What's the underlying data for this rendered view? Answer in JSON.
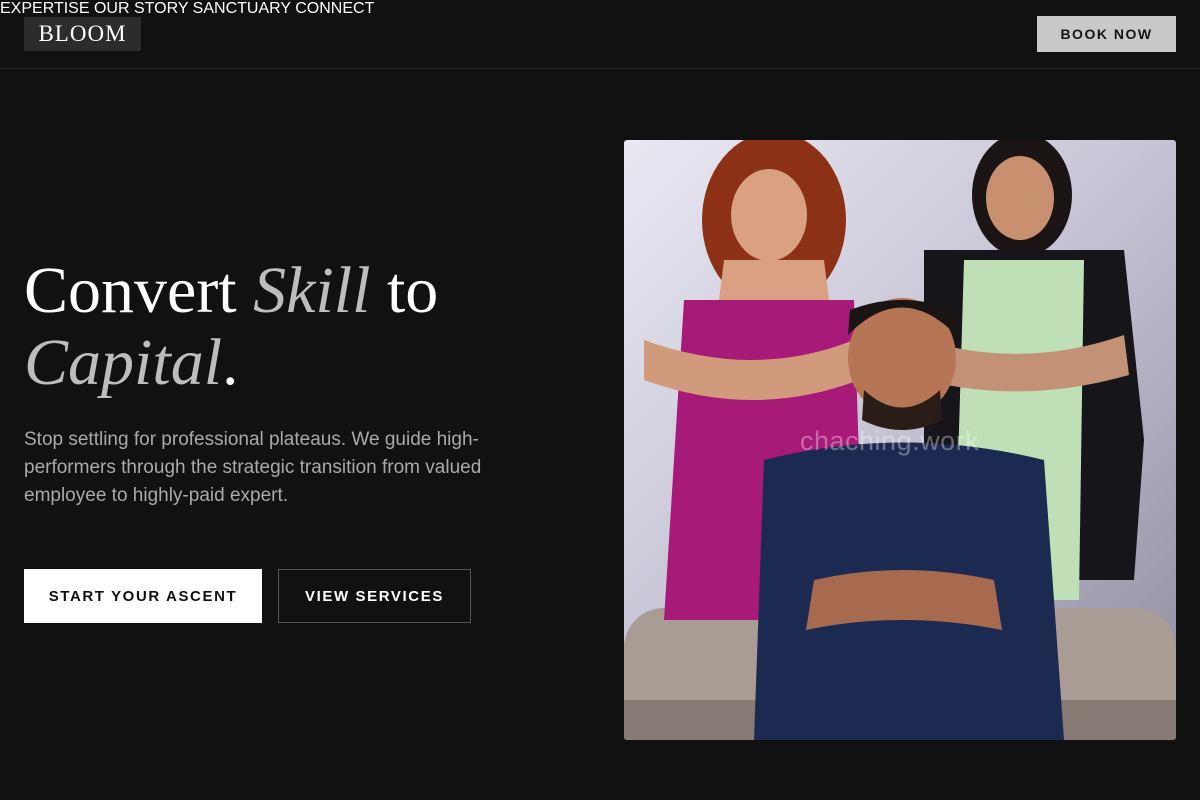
{
  "brand": {
    "logo_text": "BLOOM"
  },
  "nav": {
    "items": [
      {
        "label": "EXPERTISE"
      },
      {
        "label": "OUR STORY"
      },
      {
        "label": "SANCTUARY"
      },
      {
        "label": "CONNECT"
      }
    ],
    "cta_label": "BOOK NOW"
  },
  "hero": {
    "title_part1": "Convert ",
    "title_italic1": "Skill",
    "title_part2": " to",
    "title_italic2": "Capital",
    "title_end": ".",
    "description": "Stop settling for professional plateaus. We guide high-performers through the strategic transition from valued employee to highly-paid expert.",
    "primary_button": "START YOUR ASCENT",
    "secondary_button": "VIEW SERVICES"
  },
  "photo": {
    "watermark": "chaching.work"
  },
  "colors": {
    "background": "#121112",
    "accent_button": "#c9c9ca",
    "muted_text": "#a9a9ad"
  }
}
